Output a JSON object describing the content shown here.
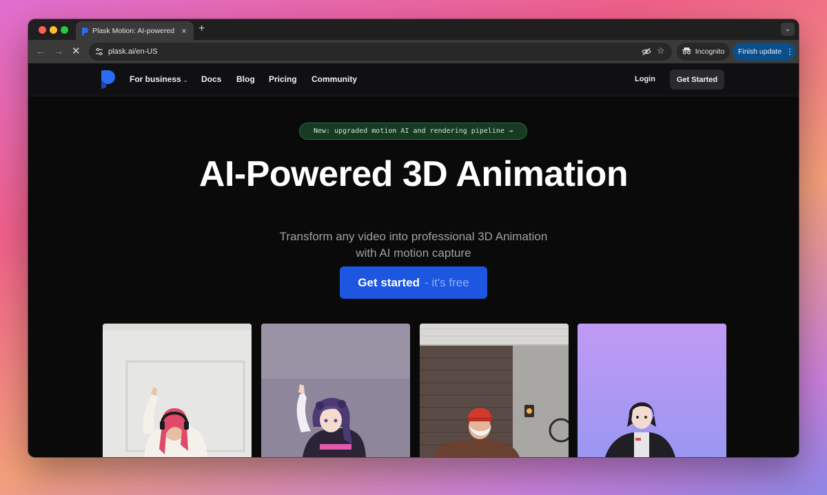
{
  "browser": {
    "tab": {
      "title": "Plask Motion: AI-powered Mo",
      "close_glyph": "×",
      "favicon": "plask-favicon-icon"
    },
    "new_tab_glyph": "+",
    "tab_search_glyph": "⌄",
    "nav": {
      "back_glyph": "←",
      "forward_glyph": "→",
      "stop_glyph": "✕"
    },
    "address": {
      "url": "plask.ai/en-US"
    },
    "star_glyph": "☆",
    "incognito_label": "Incognito",
    "finish_update_label": "Finish update",
    "kebab_glyph": "⋮"
  },
  "site": {
    "nav": {
      "for_business": "For business",
      "chevron": "⌄",
      "docs": "Docs",
      "blog": "Blog",
      "pricing": "Pricing",
      "community": "Community",
      "login": "Login",
      "get_started": "Get Started"
    },
    "hero": {
      "announcement": "New: upgraded motion AI and rendering pipeline",
      "announcement_arrow": "→",
      "headline": "AI-Powered 3D Animation",
      "subline": "Transform any video into professional 3D Animation with AI motion capture",
      "cta_main": "Get started",
      "cta_sub": "- it's free"
    },
    "cards": [
      {
        "name": "woman-with-headphones-dancing"
      },
      {
        "name": "anime-avatar-dancing"
      },
      {
        "name": "man-red-beanie-dancing"
      },
      {
        "name": "anime-avatar-idle"
      }
    ]
  },
  "colors": {
    "brand_blue": "#1d56e0",
    "finish_update": "#0b4f8a",
    "pill_green": "#163a22"
  }
}
